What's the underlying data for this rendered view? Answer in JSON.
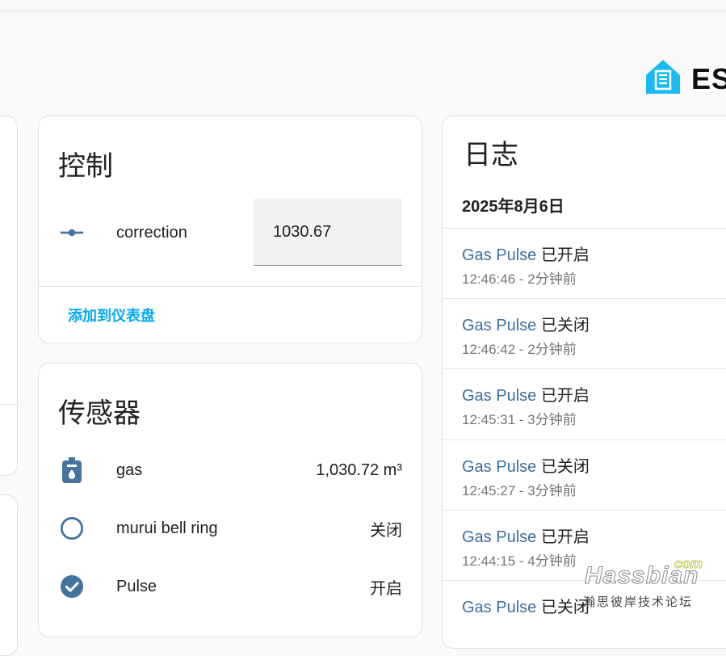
{
  "brand": {
    "logo_icon": "home-assistant-logo-icon",
    "text": "ES",
    "color": "#18bcf2"
  },
  "controls_card": {
    "title": "控制",
    "entity": {
      "icon": "slider-icon",
      "name": "correction",
      "value": "1030.67"
    },
    "add_link": "添加到仪表盘"
  },
  "sensors_card": {
    "title": "传感器",
    "rows": [
      {
        "icon": "gas-meter-icon",
        "name": "gas",
        "value": "1,030.72 m³"
      },
      {
        "icon": "circle-outline-icon",
        "name": "murui bell ring",
        "value": "关闭"
      },
      {
        "icon": "check-circle-icon",
        "name": "Pulse",
        "value": "开启"
      }
    ]
  },
  "logbook_card": {
    "title": "日志",
    "date": "2025年8月6日",
    "entries": [
      {
        "entity": "Gas Pulse",
        "state": "已开启",
        "time": "12:46:46 - 2分钟前"
      },
      {
        "entity": "Gas Pulse",
        "state": "已关闭",
        "time": "12:46:42 - 2分钟前"
      },
      {
        "entity": "Gas Pulse",
        "state": "已开启",
        "time": "12:45:31 - 3分钟前"
      },
      {
        "entity": "Gas Pulse",
        "state": "已关闭",
        "time": "12:45:27 - 3分钟前"
      },
      {
        "entity": "Gas Pulse",
        "state": "已开启",
        "time": "12:44:15 - 4分钟前"
      },
      {
        "entity": "Gas Pulse",
        "state": "已关闭",
        "time": ""
      }
    ]
  },
  "watermark": {
    "com": "com",
    "main": "Hassbian",
    "sub": "瀚思彼岸技术论坛"
  },
  "colors": {
    "accent": "#03a9f4",
    "icon": "#44739e",
    "entity_link": "#3c6e9c"
  }
}
